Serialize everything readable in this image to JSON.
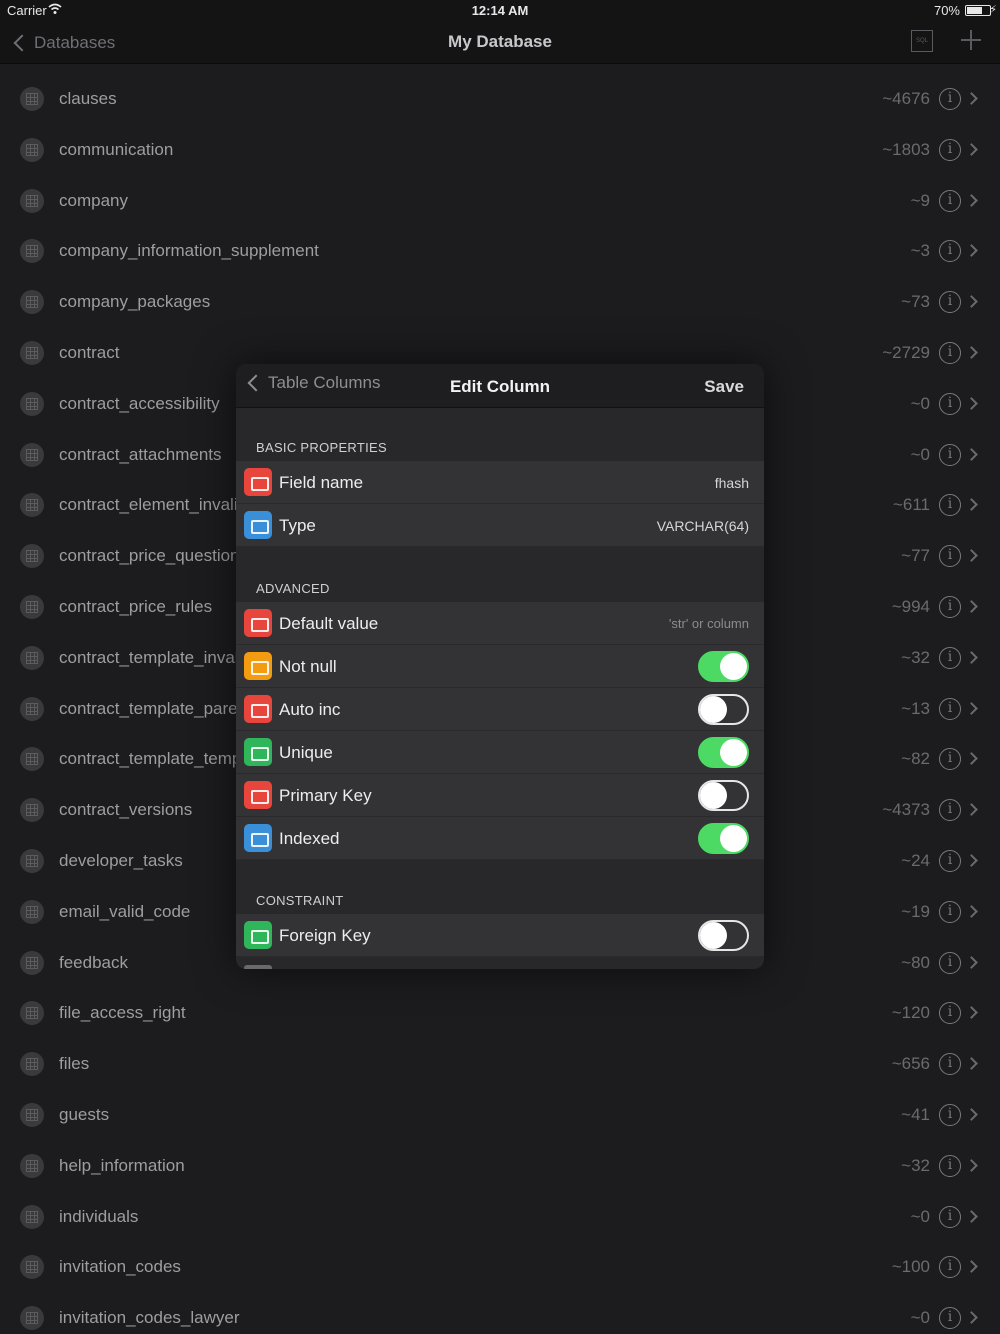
{
  "status_bar": {
    "carrier": "Carrier",
    "time": "12:14 AM",
    "battery": "70%",
    "battery_level": 0.7
  },
  "nav": {
    "back_label": "Databases",
    "title": "My Database",
    "sql_icon": "sql-icon",
    "add_icon": "plus-icon"
  },
  "tables": [
    {
      "name": "clauses",
      "count": "~4676"
    },
    {
      "name": "communication",
      "count": "~1803"
    },
    {
      "name": "company",
      "count": "~9"
    },
    {
      "name": "company_information_supplement",
      "count": "~3"
    },
    {
      "name": "company_packages",
      "count": "~73"
    },
    {
      "name": "contract",
      "count": "~2729"
    },
    {
      "name": "contract_accessibility",
      "count": "~0"
    },
    {
      "name": "contract_attachments",
      "count": "~0"
    },
    {
      "name": "contract_element_invalid",
      "count": "~611"
    },
    {
      "name": "contract_price_question",
      "count": "~77"
    },
    {
      "name": "contract_price_rules",
      "count": "~994"
    },
    {
      "name": "contract_template_invalid",
      "count": "~32"
    },
    {
      "name": "contract_template_parent",
      "count": "~13"
    },
    {
      "name": "contract_template_temp",
      "count": "~82"
    },
    {
      "name": "contract_versions",
      "count": "~4373"
    },
    {
      "name": "developer_tasks",
      "count": "~24"
    },
    {
      "name": "email_valid_code",
      "count": "~19"
    },
    {
      "name": "feedback",
      "count": "~80"
    },
    {
      "name": "file_access_right",
      "count": "~120"
    },
    {
      "name": "files",
      "count": "~656"
    },
    {
      "name": "guests",
      "count": "~41"
    },
    {
      "name": "help_information",
      "count": "~32"
    },
    {
      "name": "individuals",
      "count": "~0"
    },
    {
      "name": "invitation_codes",
      "count": "~100"
    },
    {
      "name": "invitation_codes_lawyer",
      "count": "~0"
    }
  ],
  "modal": {
    "back_label": "Table Columns",
    "title": "Edit Column",
    "save_label": "Save",
    "sections": {
      "basic": "BASIC PROPERTIES",
      "advanced": "ADVANCED",
      "constraint": "CONSTRAINT"
    },
    "field_name": {
      "label": "Field name",
      "value": "fhash",
      "icon": "text-field-icon",
      "color": "#e8463d"
    },
    "type": {
      "label": "Type",
      "value": "VARCHAR(64)",
      "icon": "variable-icon",
      "color": "#3a8fd9"
    },
    "default_value": {
      "label": "Default value",
      "placeholder": "'str' or column",
      "icon": "text-field-icon",
      "color": "#e8463d"
    },
    "toggles": [
      {
        "label": "Not null",
        "on": true,
        "icon": "not-null-icon",
        "color": "#f39c12"
      },
      {
        "label": "Auto inc",
        "on": false,
        "icon": "auto-increment-icon",
        "color": "#e8463d"
      },
      {
        "label": "Unique",
        "on": true,
        "icon": "unique-icon",
        "color": "#2fb65a"
      },
      {
        "label": "Primary Key",
        "on": false,
        "icon": "key-icon",
        "color": "#e8463d"
      },
      {
        "label": "Indexed",
        "on": true,
        "icon": "sort-index-icon",
        "color": "#3a8fd9"
      }
    ],
    "foreign_key": {
      "label": "Foreign Key",
      "on": false,
      "icon": "link-icon",
      "color": "#2fb65a"
    }
  }
}
